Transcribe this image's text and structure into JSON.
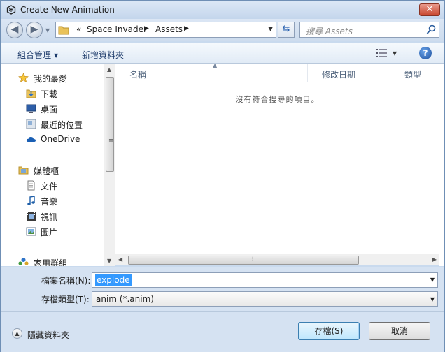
{
  "window": {
    "title": "Create New Animation",
    "close_label": "✕"
  },
  "address": {
    "prefix": "«",
    "crumbs": [
      "Space Invader",
      "Assets"
    ]
  },
  "search": {
    "placeholder": "搜尋 Assets"
  },
  "toolbar": {
    "organize_label": "組合管理",
    "new_folder_label": "新增資料夾"
  },
  "sidebar": {
    "favorites": [
      {
        "label": "我的最愛",
        "icon": "star-icon"
      },
      {
        "label": "下載",
        "icon": "download-icon"
      },
      {
        "label": "桌面",
        "icon": "desktop-icon"
      },
      {
        "label": "最近的位置",
        "icon": "recent-places-icon"
      },
      {
        "label": "OneDrive",
        "icon": "cloud-icon"
      }
    ],
    "libraries": [
      {
        "label": "媒體櫃",
        "icon": "library-icon"
      },
      {
        "label": "文件",
        "icon": "document-icon"
      },
      {
        "label": "音樂",
        "icon": "music-icon"
      },
      {
        "label": "視訊",
        "icon": "video-icon"
      },
      {
        "label": "圖片",
        "icon": "picture-icon"
      }
    ],
    "homegroup": {
      "label": "家用群組",
      "icon": "homegroup-icon"
    }
  },
  "file_list": {
    "columns": [
      "名稱",
      "修改日期",
      "類型"
    ],
    "empty_message": "沒有符合搜尋的項目。"
  },
  "form": {
    "filename_label": "檔案名稱(N):",
    "filename_value": "explode",
    "filetype_label": "存檔類型(T):",
    "filetype_value": "anim (*.anim)"
  },
  "footer": {
    "hide_folders_label": "隱藏資料夾",
    "save_label": "存檔(S)",
    "cancel_label": "取消"
  },
  "colors": {
    "accent": "#3399ff",
    "frame": "#c9daee"
  }
}
